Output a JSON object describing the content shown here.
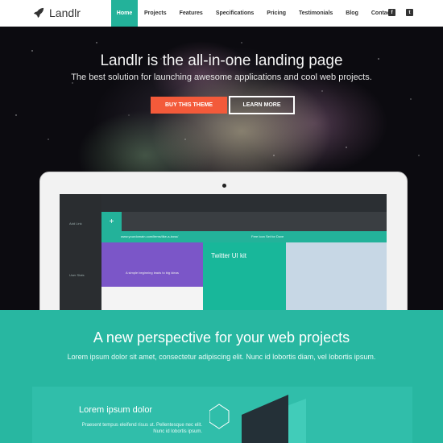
{
  "brand": {
    "name": "Landlr",
    "accent": "#23b29a",
    "cta": "#f35a3a"
  },
  "nav": {
    "items": [
      "Home",
      "Projects",
      "Features",
      "Specifications",
      "Pricing",
      "Testimonials",
      "Blog",
      "Contact"
    ],
    "active": "Home",
    "social": [
      "facebook-icon",
      "twitter-icon"
    ]
  },
  "hero": {
    "title": "Landlr is the all-in-one landing page",
    "subtitle": "The best solution for launching awesome applications and cool web projects.",
    "buy_label": "BUY THIS THEME",
    "learn_label": "LEARN MORE"
  },
  "screen": {
    "side_items": [
      "Add Link",
      "User Stats"
    ],
    "url": "www.yourdomain.com/items/like-a-boss/",
    "url_title": "Free Icon Set for Dove",
    "card_title": "Twitter UI kit",
    "purple_text": "A simple beginning leads to big ideas"
  },
  "section": {
    "title": "A new perspective for your web projects",
    "subtitle": "Lorem ipsum dolor sit amet, consectetur adipiscing elit. Nunc id lobortis diam, vel lobortis ipsum."
  },
  "feature": {
    "title": "Lorem ipsum dolor",
    "text": "Praesent tempus eleifend risus ut. Pellentesque nec elit. Nunc id lobortis ipsum."
  }
}
